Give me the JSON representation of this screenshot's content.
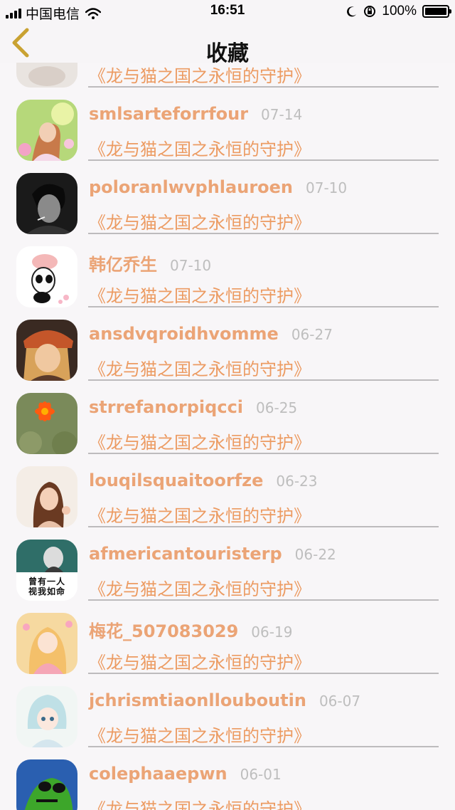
{
  "status_bar": {
    "carrier": "中国电信",
    "time": "16:51",
    "battery_percent": "100%",
    "battery_level": 1.0
  },
  "nav": {
    "title": "收藏",
    "back_icon": "chevron-left-icon"
  },
  "colors": {
    "accent": "#ec9b62",
    "username": "#eba476",
    "date": "#bebebe",
    "divider": "#bdbbbd",
    "background": "#f8f6f8"
  },
  "favorites": [
    {
      "user": "",
      "date": "",
      "title": "《龙与猫之国之永恒的守护》",
      "avatar": "partial-avatar"
    },
    {
      "user": "smlsarteforrfour",
      "date": "07-14",
      "title": "《龙与猫之国之永恒的守护》",
      "avatar": "girl-flowers-avatar"
    },
    {
      "user": "poloranlwvphlauroen",
      "date": "07-10",
      "title": "《龙与猫之国之永恒的守护》",
      "avatar": "bw-man-smoking-avatar"
    },
    {
      "user": "韩亿乔生",
      "date": "07-10",
      "title": "《龙与猫之国之永恒的守护》",
      "avatar": "cartoon-panda-avatar"
    },
    {
      "user": "ansdvqroidhvomme",
      "date": "06-27",
      "title": "《龙与猫之国之永恒的守护》",
      "avatar": "girl-headscarf-avatar"
    },
    {
      "user": "strrefanorpiqcci",
      "date": "06-25",
      "title": "《龙与猫之国之永恒的守护》",
      "avatar": "cactus-flower-avatar"
    },
    {
      "user": "louqilsquaitoorfze",
      "date": "06-23",
      "title": "《龙与猫之国之永恒的守护》",
      "avatar": "girl-peace-sign-avatar"
    },
    {
      "user": "afmericantouristerp",
      "date": "06-22",
      "title": "《龙与猫之国之永恒的守护》",
      "avatar": "girl-calligraphy-avatar",
      "avatar_text": "曾有一人 视我如命"
    },
    {
      "user": "梅花_507083029",
      "date": "06-19",
      "title": "《龙与猫之国之永恒的守护》",
      "avatar": "anime-girl-avatar"
    },
    {
      "user": "jchrismtiaonllouboutin",
      "date": "06-07",
      "title": "《龙与猫之国之永恒的守护》",
      "avatar": "anime-boy-avatar"
    },
    {
      "user": "colephaaepwn",
      "date": "06-01",
      "title": "《龙与猫之国之永恒的守护》",
      "avatar": "green-frog-avatar"
    }
  ]
}
